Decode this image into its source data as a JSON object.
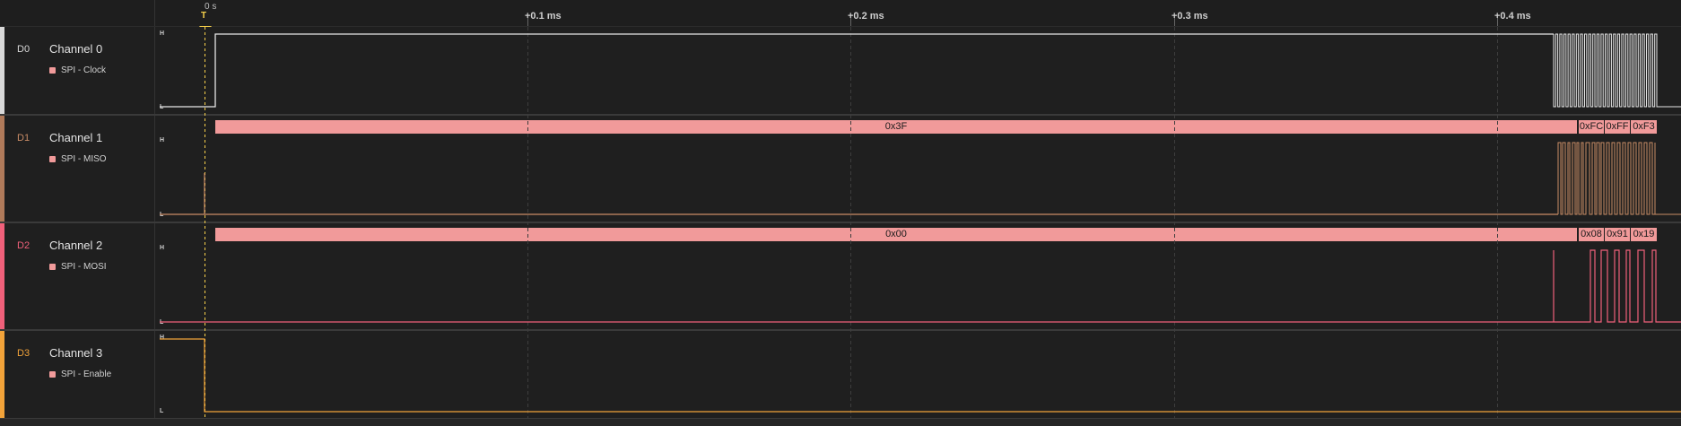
{
  "timeline": {
    "zero_label": "0 s",
    "trigger_label": "T",
    "ticks": [
      "+0.1 ms",
      "+0.2 ms",
      "+0.3 ms",
      "+0.4 ms"
    ]
  },
  "level_labels": {
    "high": "H",
    "low": "L"
  },
  "channels": [
    {
      "id": "D0",
      "name": "Channel 0",
      "analyzer": "SPI - Clock",
      "color": "#d9d9d9"
    },
    {
      "id": "D1",
      "name": "Channel 1",
      "analyzer": "SPI - MISO",
      "color": "#b07a5a",
      "decodes": [
        "0x3F",
        "0xFC",
        "0xFF",
        "0xF3"
      ]
    },
    {
      "id": "D2",
      "name": "Channel 2",
      "analyzer": "SPI - MOSI",
      "color": "#f0607a",
      "decodes": [
        "0x00",
        "0x08",
        "0x91",
        "0x19"
      ]
    },
    {
      "id": "D3",
      "name": "Channel 3",
      "analyzer": "SPI - Enable",
      "color": "#f2a33a"
    }
  ],
  "colors": {
    "background": "#1e1e1e",
    "decode": "#f19a9a",
    "trigger": "#f7d14b"
  }
}
